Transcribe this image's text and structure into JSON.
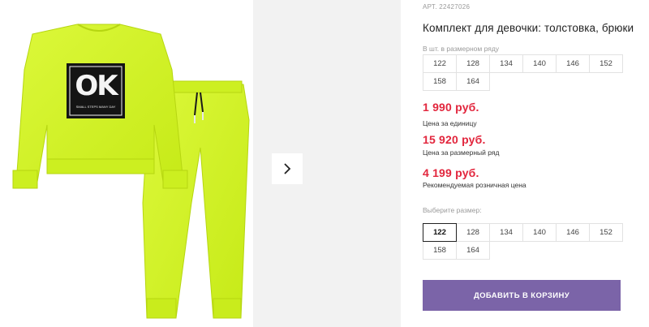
{
  "product": {
    "sku": "АРТ. 22427026",
    "title": "Комплект для девочки: толстовка, брюки",
    "image": {
      "logo_text": "OK",
      "print_text": "SMALL STEPS MANY DAY"
    }
  },
  "row_sizes": {
    "label": "В шт. в размерном ряду",
    "items": [
      "122",
      "128",
      "134",
      "140",
      "146",
      "152",
      "158",
      "164"
    ]
  },
  "prices": {
    "unit_price": "1 990 руб.",
    "unit_label": "Цена за единицу",
    "row_price": "15 920 руб.",
    "row_label": "Цена за размерный ряд",
    "retail_price": "4 199 руб.",
    "retail_label": "Рекомендуемая розничная цена"
  },
  "size_select": {
    "label": "Выберите размер:",
    "selected": "122",
    "options": [
      "122",
      "128",
      "134",
      "140",
      "146",
      "152",
      "158",
      "164"
    ]
  },
  "cart": {
    "button_label": "ДОБАВИТЬ В КОРЗИНУ"
  },
  "colors": {
    "accent": "#7b64a8",
    "price": "#e2263d",
    "garment": "#d4f52a"
  },
  "icons": {
    "next": "chevron-right-icon"
  }
}
